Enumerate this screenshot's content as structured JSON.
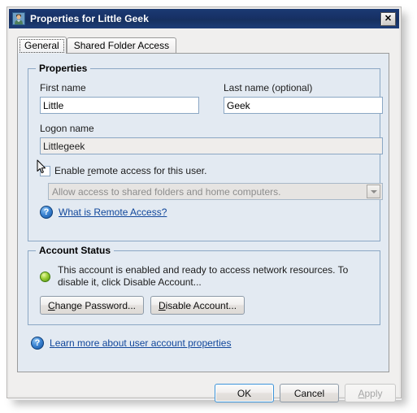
{
  "window": {
    "title": "Properties for Little Geek",
    "title_icon": "user-icon",
    "close_label": "✕"
  },
  "tabs": [
    {
      "label": "General",
      "selected": true
    },
    {
      "label": "Shared Folder Access",
      "selected": false
    }
  ],
  "properties_group": {
    "title": "Properties",
    "first_name_label": "First name",
    "first_name_value": "Little",
    "last_name_label": "Last name (optional)",
    "last_name_value": "Geek",
    "logon_name_label": "Logon name",
    "logon_name_value": "Littlegeek",
    "enable_remote_prefix": "Enable ",
    "enable_remote_accel": "r",
    "enable_remote_suffix": "emote access for this user.",
    "enable_remote_checked": false,
    "remote_access_option": "Allow access to shared folders and home computers.",
    "remote_help_icon": "help-question-icon",
    "remote_help_accel": "W",
    "remote_help_rest": "hat is Remote Access?"
  },
  "account_status_group": {
    "title": "Account Status",
    "status_icon": "green-enabled-icon",
    "status_text": "This account is enabled and ready to access network resources. To disable it, click Disable Account...",
    "change_password_accel": "C",
    "change_password_rest": "hange Password...",
    "disable_account_accel": "D",
    "disable_account_rest": "isable Account..."
  },
  "page_help": {
    "icon": "help-question-icon",
    "accel": "L",
    "rest": "earn more about user account properties"
  },
  "footer_buttons": {
    "ok": "OK",
    "cancel": "Cancel",
    "apply_accel": "A",
    "apply_rest": "pply",
    "apply_disabled": true
  },
  "colors": {
    "titlebar": "#173166",
    "tabpage_bg": "#e3eaf2",
    "dialog_bg": "#f0efee",
    "group_border": "#8ba7c4",
    "link": "#11479b",
    "status_green": "#9fd13a",
    "default_button_border": "#3c93d8"
  }
}
